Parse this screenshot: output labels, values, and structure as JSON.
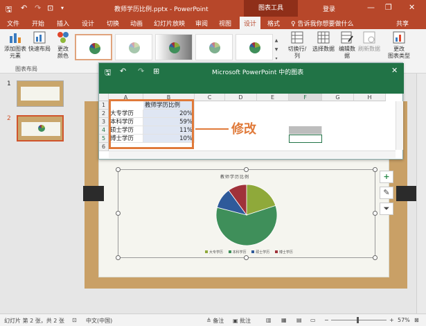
{
  "titlebar": {
    "doc_title": "教师学历比例.pptx - PowerPoint",
    "context_tools": "图表工具",
    "login": "登录",
    "save_icon": "save-icon",
    "minimize": "—",
    "restore": "❐",
    "close": "✕"
  },
  "tabs": [
    {
      "label": "文件"
    },
    {
      "label": "开始"
    },
    {
      "label": "插入"
    },
    {
      "label": "设计"
    },
    {
      "label": "切换"
    },
    {
      "label": "动画"
    },
    {
      "label": "幻灯片放映"
    },
    {
      "label": "审阅"
    },
    {
      "label": "视图"
    },
    {
      "label": "设计"
    },
    {
      "label": "格式"
    }
  ],
  "tellme": "♀ 告诉我你想要做什么",
  "share": "共享",
  "ribbon": {
    "add_element": "添加图表\n元素",
    "quick_layout": "快速布局",
    "change_colors": "更改\n颜色",
    "group_chart_layout": "图表布局",
    "switch_rowcol": "切换行/列",
    "select_data": "选择数据",
    "edit_data": "编辑数\n据",
    "refresh_data": "刷新数据",
    "change_chart_type": "更改\n图表类型"
  },
  "slides": [
    {
      "num": "1"
    },
    {
      "num": "2"
    }
  ],
  "datawindow": {
    "title": "Microsoft PowerPoint 中的图表",
    "columns": [
      "A",
      "B",
      "C",
      "D",
      "E",
      "F",
      "G",
      "H"
    ],
    "rows": [
      "1",
      "2",
      "3",
      "4",
      "5",
      "6"
    ],
    "header_cell": "教师学历比例",
    "data": [
      {
        "label": "大专学历",
        "value": "20%"
      },
      {
        "label": "本科学历",
        "value": "59%"
      },
      {
        "label": "硕士学历",
        "value": "11%"
      },
      {
        "label": "博士学历",
        "value": "10%"
      }
    ]
  },
  "annotation": "修改",
  "chart": {
    "title": "教师学历比例",
    "legend": [
      "大专学历",
      "本科学历",
      "硕士学历",
      "博士学历"
    ],
    "colors": [
      "#8fa93a",
      "#3f8f5a",
      "#2f5a9a",
      "#a0323a"
    ]
  },
  "chart_data": {
    "type": "pie",
    "title": "教师学历比例",
    "categories": [
      "大专学历",
      "本科学历",
      "硕士学历",
      "博士学历"
    ],
    "values": [
      20,
      59,
      11,
      10
    ]
  },
  "statusbar": {
    "slide_info": "幻灯片 第 2 张，共 2 张",
    "language": "中文(中国)",
    "notes": "备注",
    "comments": "批注",
    "zoom": "57%"
  }
}
